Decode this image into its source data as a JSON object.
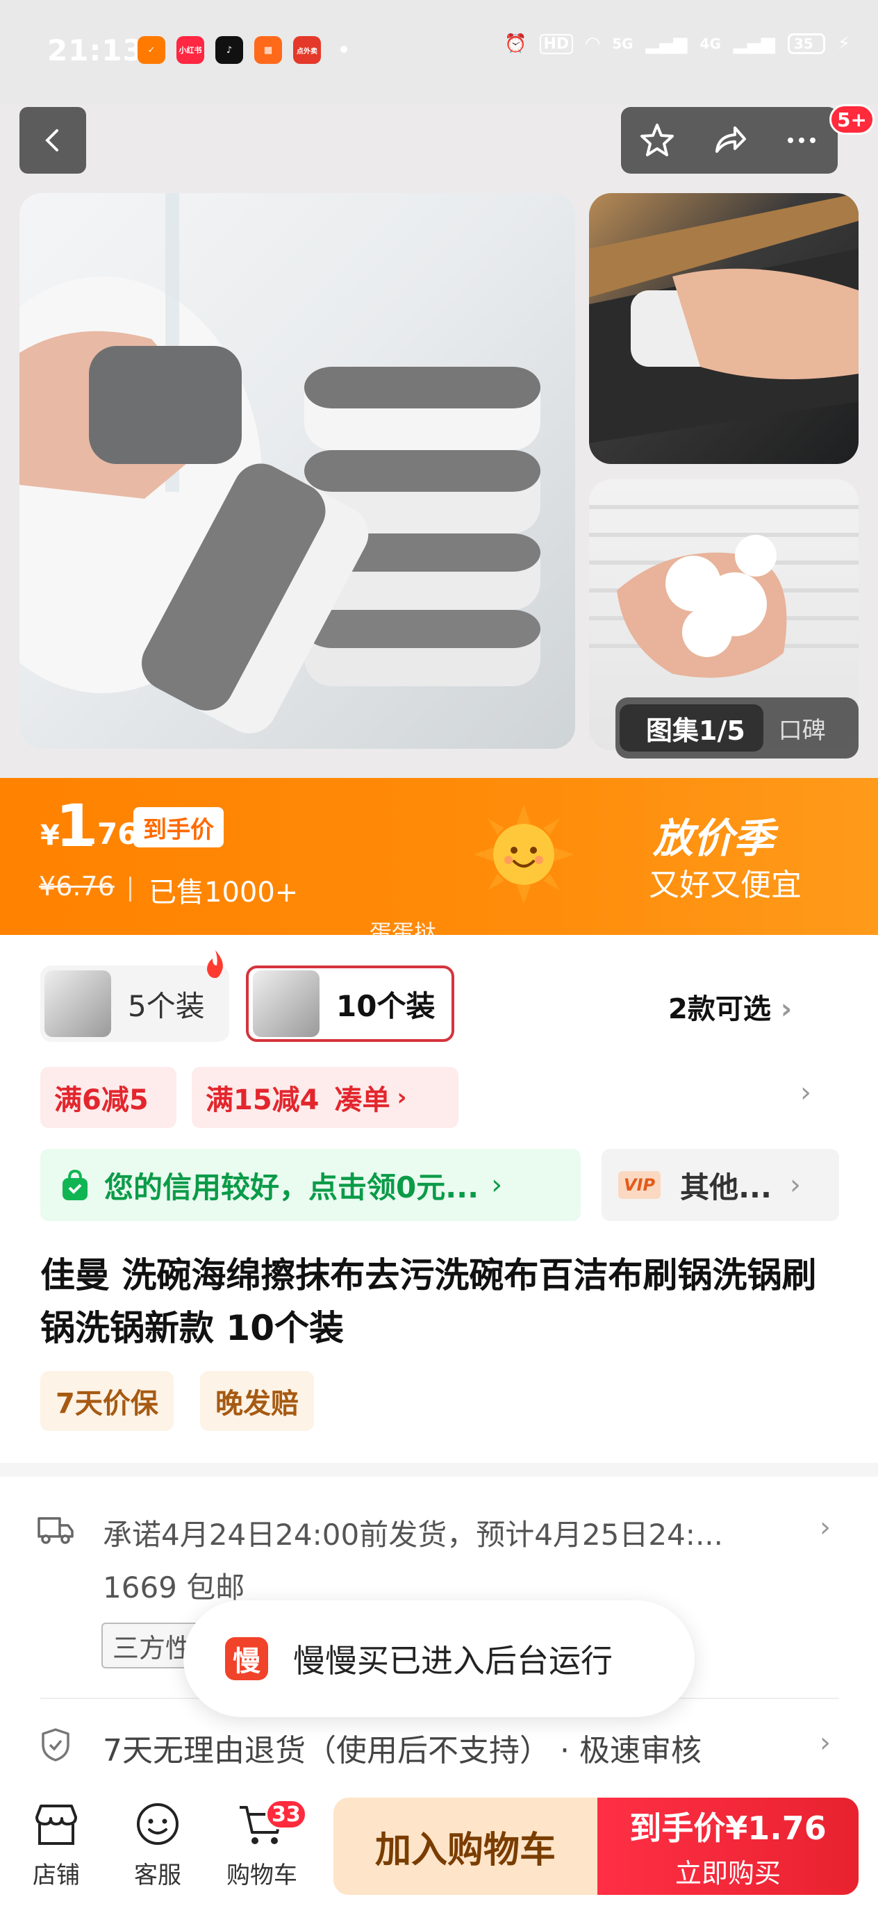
{
  "status_bar": {
    "time": "21:13",
    "apps": [
      "小红书",
      "",
      "",
      "点外卖"
    ],
    "network": "5G",
    "network2": "4G",
    "hd": "HD",
    "battery": "35"
  },
  "gallery": {
    "label": "图集1/5",
    "reviews": "口碑"
  },
  "price": {
    "currency": "¥",
    "integer": "1",
    "decimal": ".76",
    "to_hand_label": "到手价",
    "original": "¥6.76",
    "sold": "已售1000+",
    "banner_title": "放价季",
    "banner_sub": "又好又便宜",
    "watermark": "蛋蛋挞"
  },
  "sku": {
    "options": [
      {
        "label": "5个装",
        "selected": false
      },
      {
        "label": "10个装",
        "selected": true
      }
    ],
    "more": "2款可选"
  },
  "promos": [
    "满6减5",
    "满15减4",
    "凑单"
  ],
  "credit": "您的信用较好，点击领0元...",
  "vip": {
    "badge": "VIP",
    "label": "其他..."
  },
  "title": "佳曼 洗碗海绵擦抹布去污洗碗布百洁布刷锅洗锅刷锅洗锅新款 10个装",
  "tags": [
    "7天价保",
    "晚发赔"
  ],
  "shipping": {
    "line1": "承诺4月24日24:00前发货，预计4月25日24:...",
    "line2": "1669  包邮",
    "tag": "三方性"
  },
  "toast": {
    "logo": "慢",
    "text": "慢慢买已进入后台运行"
  },
  "returns": "7天无理由退货（使用后不支持） · 极速审核",
  "bottom": {
    "shop": "店铺",
    "service": "客服",
    "cart": "购物车",
    "cart_count": "33",
    "add_cart": "加入购物车",
    "buy_price": "到手价¥1.76",
    "buy_now": "立即购买"
  },
  "badge_more": "5+",
  "colors": {
    "accent": "#ff8a00",
    "red": "#f0283a",
    "green": "#0b9b48"
  }
}
